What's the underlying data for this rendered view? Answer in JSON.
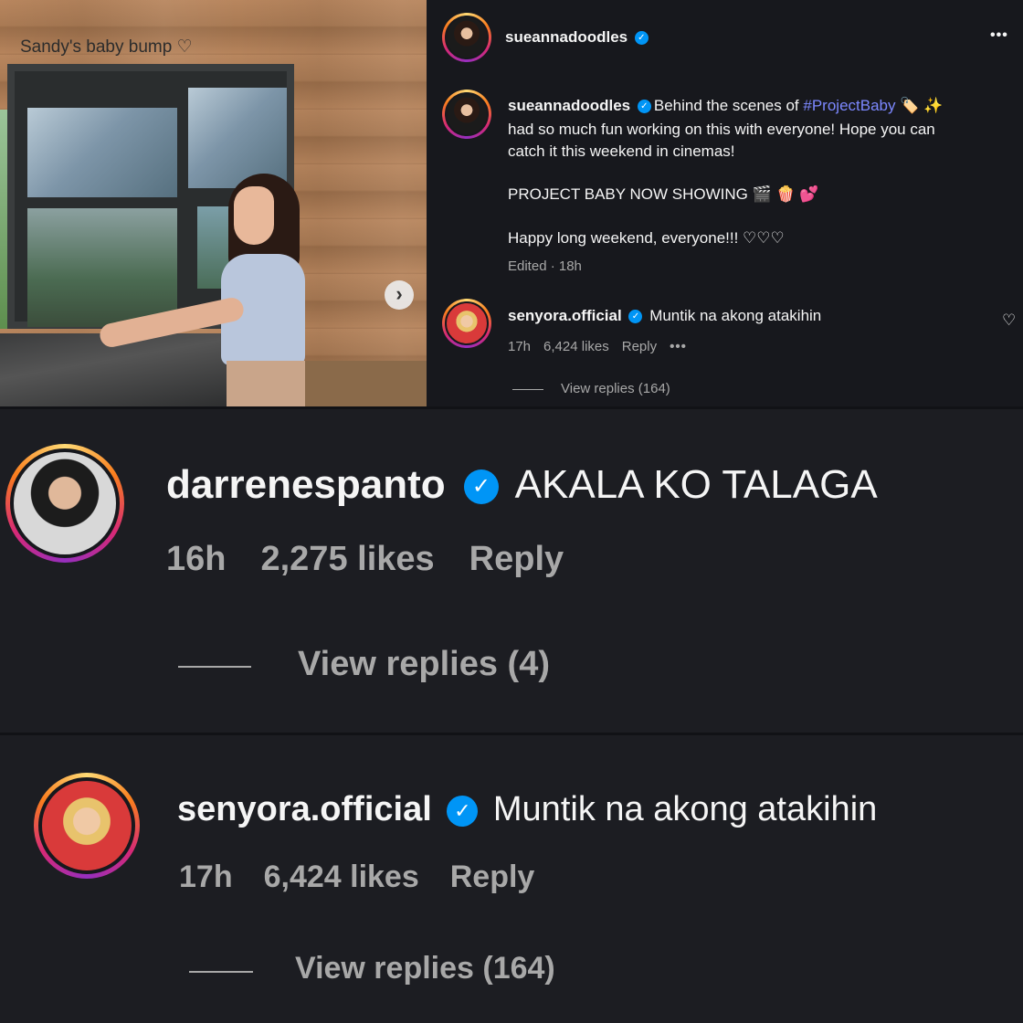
{
  "post": {
    "photo_caption": "Sandy's baby bump ♡",
    "next_icon": "chevron-right-icon",
    "header": {
      "username": "sueannadoodles",
      "more_label": "•••"
    },
    "caption": {
      "username": "sueannadoodles",
      "line1_pre": "Behind the scenes of ",
      "hashtag": "#ProjectBaby",
      "line1_emoji": " 🏷️ ✨",
      "line2": "had so much fun working on this with everyone! Hope you can",
      "line3": "catch it this weekend in cinemas!",
      "line4": "PROJECT BABY NOW SHOWING 🎬 🍿 💕",
      "line5": "Happy long weekend, everyone!!! ♡♡♡",
      "edited": "Edited · 18h"
    },
    "comment": {
      "username": "senyora.official",
      "text": "Muntik na akong atakihin",
      "time": "17h",
      "likes": "6,424 likes",
      "reply": "Reply",
      "more": "•••",
      "view_replies": "View replies (164)",
      "heart": "♡"
    }
  },
  "zoom_comment_1": {
    "username": "darrenespanto",
    "text": "AKALA KO TALAGA",
    "time": "16h",
    "likes": "2,275 likes",
    "reply": "Reply",
    "view_replies": "View replies (4)"
  },
  "zoom_comment_2": {
    "username": "senyora.official",
    "text": "Muntik na akong atakihin",
    "time": "17h",
    "likes": "6,424 likes",
    "reply": "Reply",
    "view_replies": "View replies (164)"
  },
  "verified_mark": "✓",
  "colors": {
    "background": "#17181d",
    "verified": "#0095f6",
    "hashtag": "#7c88ff",
    "muted": "#a8a8a8"
  }
}
